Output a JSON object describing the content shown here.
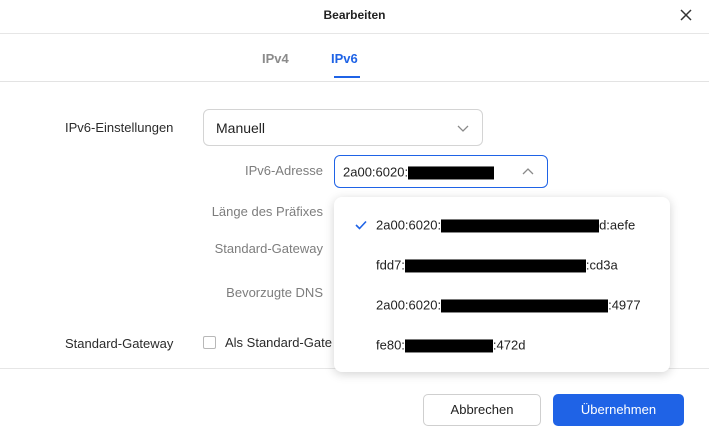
{
  "dialog": {
    "title": "Bearbeiten"
  },
  "tabs": [
    {
      "label": "IPv4"
    },
    {
      "label": "IPv6",
      "active": true
    }
  ],
  "form": {
    "ipv6_settings_label": "IPv6-Einstellungen",
    "ipv6_settings_value": "Manuell",
    "ipv6_address_label": "IPv6-Adresse",
    "ipv6_address_value_prefix": "2a00:6020:",
    "prefix_length_label": "Länge des Präfixes",
    "gateway_label": "Standard-Gateway",
    "dns_label": "Bevorzugte DNS",
    "default_gateway_section_label": "Standard-Gateway",
    "default_gateway_checkbox_label": "Als Standard-Gateway",
    "default_gateway_checked": false
  },
  "dropdown": {
    "options": [
      {
        "prefix": "2a00:6020:",
        "suffix": "d:aefe",
        "selected": true
      },
      {
        "prefix": "fdd7:",
        "suffix": ":cd3a",
        "selected": false
      },
      {
        "prefix": "2a00:6020:",
        "suffix": ":4977",
        "selected": false
      },
      {
        "prefix": "fe80:",
        "suffix": ":472d",
        "selected": false
      }
    ]
  },
  "footer": {
    "cancel_label": "Abbrechen",
    "apply_label": "Übernehmen"
  },
  "colors": {
    "accent": "#1f63e6",
    "text": "#1f1f1f",
    "muted": "#7d7d7d",
    "border": "#d4d4d4"
  }
}
